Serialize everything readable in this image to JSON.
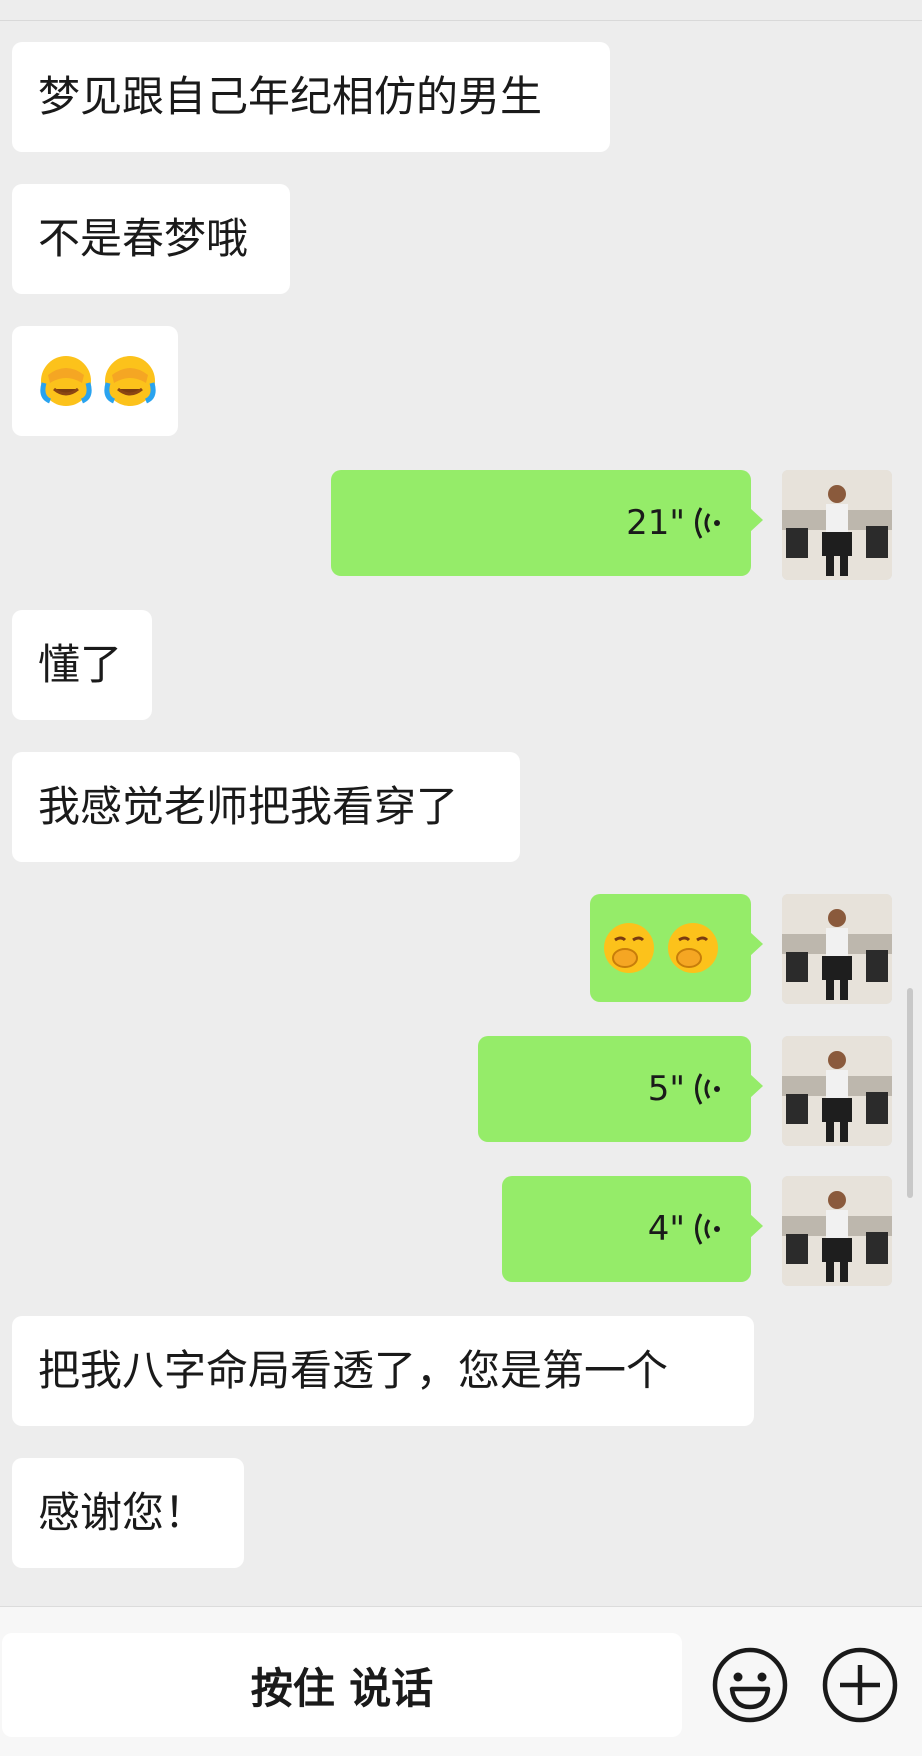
{
  "messages": [
    {
      "side": "left",
      "type": "text",
      "text": "梦见跟自己年纪相仿的男生"
    },
    {
      "side": "left",
      "type": "text",
      "text": "不是春梦哦"
    },
    {
      "side": "left",
      "type": "emoji",
      "emoji": [
        "facepalm-crying-emoji",
        "facepalm-crying-emoji"
      ]
    },
    {
      "side": "right",
      "type": "voice",
      "duration": "21\""
    },
    {
      "side": "left",
      "type": "text",
      "text": "懂了"
    },
    {
      "side": "left",
      "type": "text",
      "text": "我感觉老师把我看穿了"
    },
    {
      "side": "right",
      "type": "emoji",
      "emoji": [
        "snicker-emoji",
        "snicker-emoji"
      ]
    },
    {
      "side": "right",
      "type": "voice",
      "duration": "5\""
    },
    {
      "side": "right",
      "type": "voice",
      "duration": "4\""
    },
    {
      "side": "left",
      "type": "text",
      "text": "把我八字命局看透了，您是第一个"
    },
    {
      "side": "left",
      "type": "text",
      "text": "感谢您！"
    }
  ],
  "input_bar": {
    "hold_to_talk_label": "按住 说话",
    "emoji_button_icon": "smiley-icon",
    "more_button_icon": "plus-circle-icon"
  },
  "colors": {
    "background": "#ededed",
    "left_bubble": "#ffffff",
    "right_bubble": "#95ec69"
  }
}
